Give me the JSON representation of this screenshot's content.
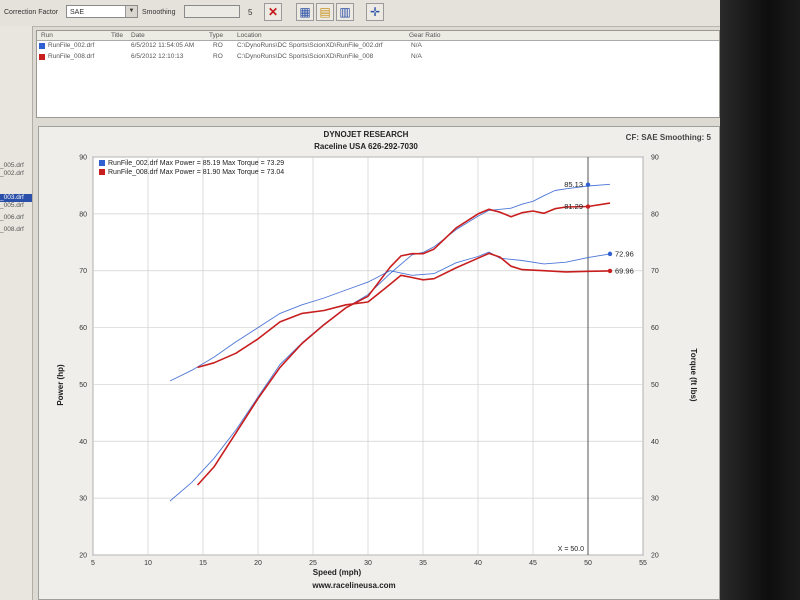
{
  "toolbar": {
    "correction_label": "Correction Factor",
    "correction_value": "SAE",
    "smoothing_label": "Smoothing",
    "smoothing_value": "5"
  },
  "left_panel": {
    "files": [
      "_005.drf",
      "_002.drf",
      "_003.drf",
      "_005.drf",
      "_006.drf",
      "_008.drf"
    ],
    "selected_index": 2
  },
  "file_table": {
    "headers": [
      "Run",
      "Title",
      "Date",
      "Type",
      "Location",
      "Gear Ratio"
    ],
    "rows": [
      {
        "run": "RunFile_002.drf",
        "title": "",
        "date": "6/5/2012 11:54:05 AM",
        "type": "RO",
        "location": "C:\\DynoRuns\\DC Sports\\ScionXD\\RunFile_002.drf",
        "gear": "N/A",
        "color": "#2f5fd0"
      },
      {
        "run": "RunFile_008.drf",
        "title": "",
        "date": "6/5/2012 12:10:13",
        "type": "RO",
        "location": "C:\\DynoRuns\\DC Sports\\ScionXD\\RunFile_008",
        "gear": "N/A",
        "color": "#c81e1e"
      }
    ]
  },
  "chart_data": {
    "type": "line",
    "title": "DYNOJET RESEARCH",
    "subtitle": "Raceline USA 626-292-7030",
    "header_right": "CF: SAE  Smoothing: 5",
    "footer": "www.racelineusa.com",
    "xlabel": "Speed (mph)",
    "ylabel_left": "Power (hp)",
    "ylabel_right": "Torque (ft lbs)",
    "xlim": [
      5,
      55
    ],
    "ylim": [
      20,
      90
    ],
    "x_ticks": [
      5,
      10,
      15,
      20,
      25,
      30,
      35,
      40,
      45,
      50,
      55
    ],
    "y_ticks": [
      20,
      30,
      40,
      50,
      60,
      70,
      80,
      90
    ],
    "grid": true,
    "legend_position": "top-left",
    "legend": [
      {
        "text": "RunFile_002.drf Max Power = 85.19 Max Torque = 73.29",
        "color": "#2f5fd0"
      },
      {
        "text": "RunFile_008.drf Max Power = 81.90 Max Torque = 73.04",
        "color": "#c81e1e"
      }
    ],
    "cursor": {
      "x": 50.0,
      "label": "X = 50.0"
    },
    "series": [
      {
        "name": "RunFile_002.drf",
        "measure": "Power",
        "color": "#2f5fd0",
        "x": [
          12,
          14,
          16,
          18,
          20,
          22,
          24,
          26,
          28,
          30,
          32,
          34,
          35,
          36,
          38,
          40,
          41,
          42,
          43,
          44,
          45,
          46,
          47,
          48,
          50,
          52
        ],
        "y": [
          29.5,
          32.8,
          37,
          42,
          47.8,
          53.5,
          57.3,
          60.6,
          63.5,
          65.8,
          69.5,
          72.8,
          73.2,
          74.2,
          77.2,
          79.6,
          80.6,
          80.8,
          81.0,
          81.7,
          82.2,
          83.2,
          84.1,
          84.4,
          84.9,
          85.19
        ]
      },
      {
        "name": "RunFile_008.drf",
        "measure": "Power",
        "color": "#c81e1e",
        "x": [
          14.5,
          16,
          18,
          20,
          22,
          24,
          26,
          28,
          30,
          32,
          33,
          34,
          35,
          36,
          38,
          40,
          41,
          42,
          43,
          44,
          45,
          46,
          47,
          48,
          50,
          52
        ],
        "y": [
          32.3,
          35.5,
          41.5,
          47.5,
          53,
          57.2,
          60.5,
          63.5,
          65.5,
          70.6,
          72.6,
          73.0,
          73.0,
          73.8,
          77.5,
          80.0,
          80.8,
          80.3,
          79.5,
          80.2,
          80.5,
          80.1,
          80.9,
          81.2,
          81.3,
          81.9
        ]
      },
      {
        "name": "RunFile_002.drf",
        "measure": "Torque",
        "color": "#2f5fd0",
        "x": [
          12,
          14,
          16,
          18,
          20,
          22,
          24,
          26,
          28,
          30,
          32,
          34,
          36,
          38,
          40,
          41,
          42,
          44,
          46,
          48,
          50,
          52
        ],
        "y": [
          50.6,
          52.5,
          54.8,
          57.5,
          60,
          62.5,
          64,
          65.2,
          66.6,
          68,
          70.0,
          69.2,
          69.5,
          71.4,
          72.5,
          73.29,
          72.2,
          71.8,
          71.2,
          71.5,
          72.3,
          72.96
        ]
      },
      {
        "name": "RunFile_008.drf",
        "measure": "Torque",
        "color": "#c81e1e",
        "x": [
          14.5,
          16,
          18,
          20,
          22,
          24,
          26,
          28,
          30,
          32,
          33,
          34,
          35,
          36,
          38,
          40,
          41,
          42,
          43,
          44,
          46,
          48,
          50,
          52
        ],
        "y": [
          53,
          53.8,
          55.5,
          58,
          61,
          62.5,
          63,
          64,
          64.5,
          67.6,
          69.2,
          68.8,
          68.4,
          68.6,
          70.5,
          72.2,
          73.04,
          72.4,
          70.8,
          70.2,
          70.0,
          69.8,
          69.9,
          69.96
        ]
      }
    ],
    "value_labels": [
      {
        "x": 50,
        "y": 85.13,
        "text": "85.13",
        "color": "#2f5fd0"
      },
      {
        "x": 50,
        "y": 81.29,
        "text": "81.29",
        "color": "#c81e1e"
      },
      {
        "x": 52,
        "y": 72.96,
        "text": "72.96",
        "color": "#2f5fd0"
      },
      {
        "x": 52,
        "y": 69.96,
        "text": "69.96",
        "color": "#c81e1e"
      }
    ]
  }
}
